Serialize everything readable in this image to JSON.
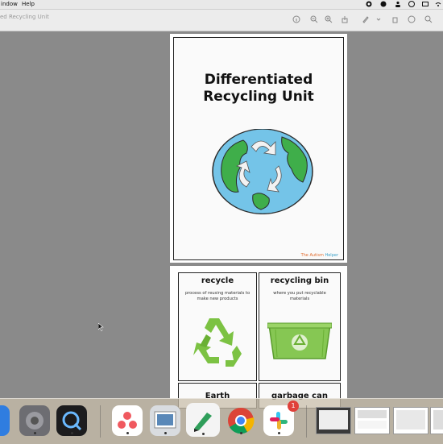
{
  "menubar": {
    "window": "indow",
    "help": "Help"
  },
  "toolbar": {
    "title": "ed Recycling Unit"
  },
  "document": {
    "title_line1": "Differentiated",
    "title_line2": "Recycling Unit",
    "brand_prefix": "The Autism",
    "brand_suffix": " Helper"
  },
  "cards": [
    {
      "title": "recycle",
      "desc": "process of reusing materials to make new products"
    },
    {
      "title": "recycling bin",
      "desc": "where you put recyclable materials"
    },
    {
      "title": "Earth",
      "desc": ""
    },
    {
      "title": "garbage can",
      "desc": ""
    }
  ],
  "dock": {
    "slack_badge": "1"
  },
  "colors": {
    "accent_green": "#7cc243",
    "earth_blue": "#74c4e8",
    "earth_green": "#3fae4a"
  }
}
